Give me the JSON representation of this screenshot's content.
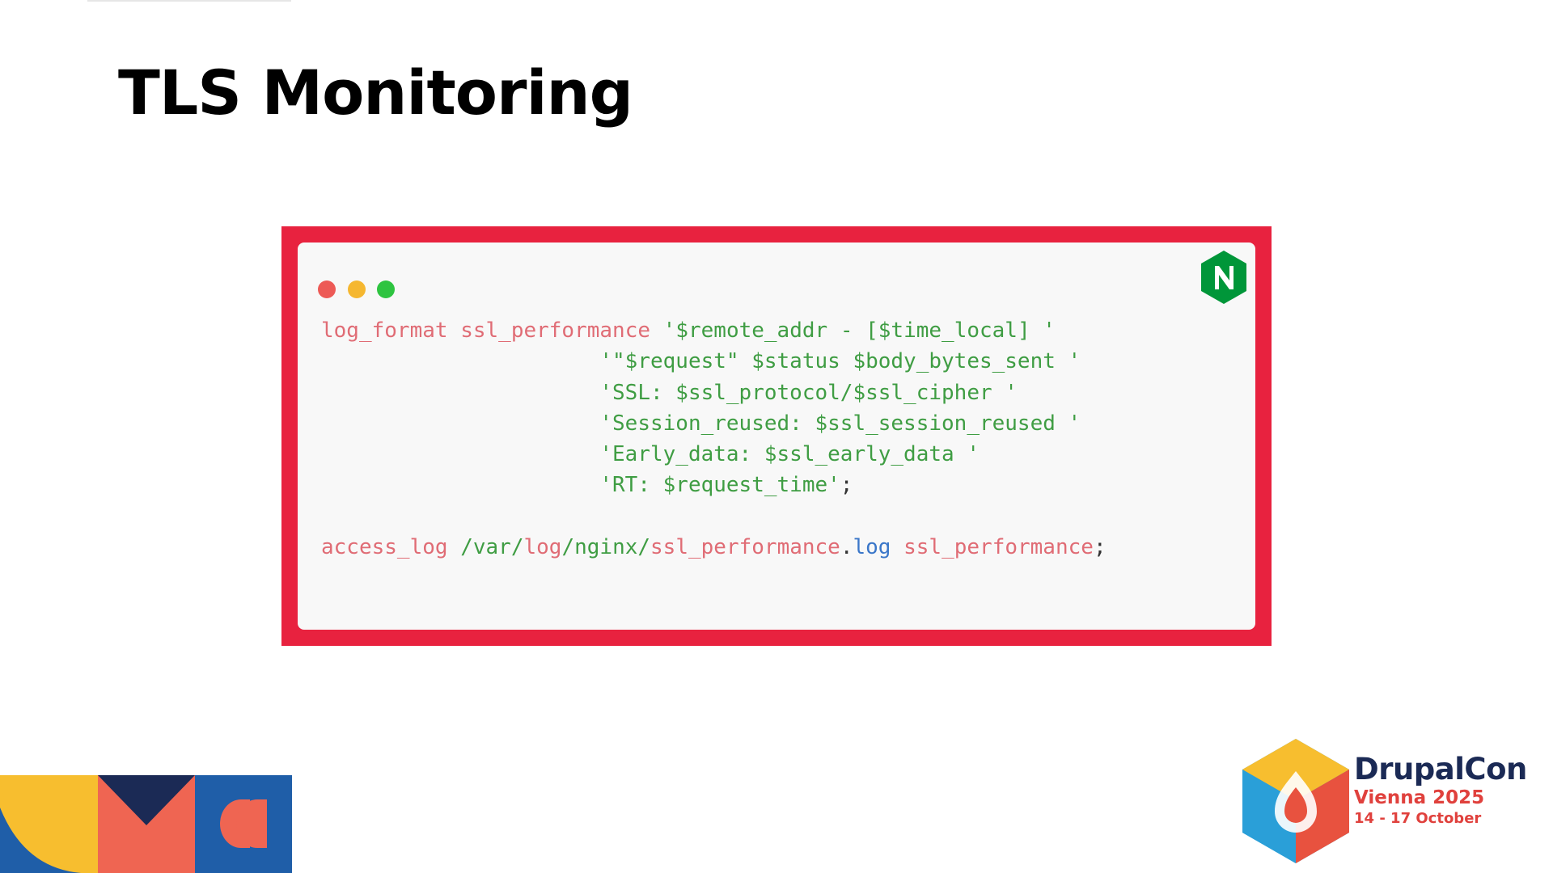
{
  "slide": {
    "title": "TLS Monitoring"
  },
  "code_window": {
    "icons": [
      "window-close-dot",
      "window-minimize-dot",
      "window-maximize-dot",
      "nginx-logo"
    ],
    "lines": [
      {
        "tokens": [
          {
            "text": "log_format",
            "kind": "kw"
          },
          {
            "text": " ",
            "kind": "punct"
          },
          {
            "text": "ssl_performance",
            "kind": "kw"
          },
          {
            "text": " ",
            "kind": "punct"
          },
          {
            "text": "'$remote_addr - [$time_local] '",
            "kind": "str"
          }
        ]
      },
      {
        "tokens": [
          {
            "text": "                      ",
            "kind": "punct"
          },
          {
            "text": "'\"$request\" $status $body_bytes_sent '",
            "kind": "str"
          }
        ]
      },
      {
        "tokens": [
          {
            "text": "                      ",
            "kind": "punct"
          },
          {
            "text": "'SSL: $ssl_protocol/$ssl_cipher '",
            "kind": "str"
          }
        ]
      },
      {
        "tokens": [
          {
            "text": "                      ",
            "kind": "punct"
          },
          {
            "text": "'Session_reused: $ssl_session_reused '",
            "kind": "str"
          }
        ]
      },
      {
        "tokens": [
          {
            "text": "                      ",
            "kind": "punct"
          },
          {
            "text": "'Early_data: $ssl_early_data '",
            "kind": "str"
          }
        ]
      },
      {
        "tokens": [
          {
            "text": "                      ",
            "kind": "punct"
          },
          {
            "text": "'RT: $request_time'",
            "kind": "str"
          },
          {
            "text": ";",
            "kind": "punct"
          }
        ]
      },
      {
        "tokens": []
      },
      {
        "tokens": [
          {
            "text": "access_log",
            "kind": "kw"
          },
          {
            "text": " ",
            "kind": "punct"
          },
          {
            "text": "/var/",
            "kind": "path"
          },
          {
            "text": "log",
            "kind": "kw"
          },
          {
            "text": "/nginx/",
            "kind": "path"
          },
          {
            "text": "ssl_performance",
            "kind": "kw"
          },
          {
            "text": ".",
            "kind": "punct"
          },
          {
            "text": "log",
            "kind": "ext"
          },
          {
            "text": " ",
            "kind": "punct"
          },
          {
            "text": "ssl_performance",
            "kind": "kw"
          },
          {
            "text": ";",
            "kind": "punct"
          }
        ]
      }
    ]
  },
  "branding": {
    "name": "DrupalCon",
    "city": "Vienna 2025",
    "dates": "14 - 17 October",
    "logo_icon": "drupalcon-hexagon-drop-logo"
  },
  "colors": {
    "frame_border": "#e8223f",
    "code_background": "#f8f8f8",
    "keyword": "#e06c75",
    "string": "#3f9d43",
    "extension": "#3b77c9",
    "nginx_green": "#009639",
    "brand_navy": "#1b2a55",
    "brand_red": "#e0413d"
  }
}
